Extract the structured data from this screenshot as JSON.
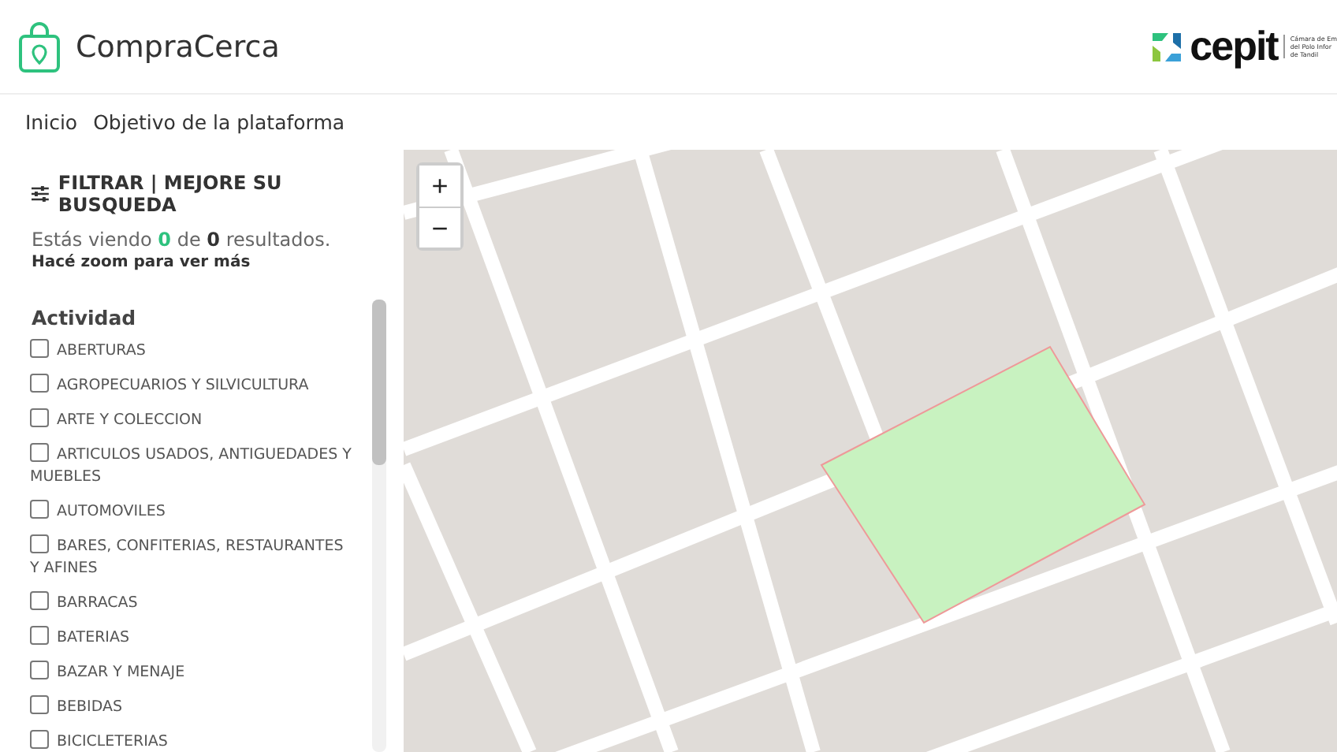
{
  "header": {
    "brand": "CompraCerca",
    "partner_logo": {
      "name": "cepit",
      "tagline": [
        "Cámara de Em",
        "del Polo Infor",
        "de Tandil"
      ]
    }
  },
  "nav": [
    "Inicio",
    "Objetivo de la plataforma"
  ],
  "filter": {
    "title": "FILTRAR | MEJORE SU BUSQUEDA",
    "results": "Estás viendo **0** de **0** resultados.",
    "hint": "Hacé zoom para ver más",
    "section": "Actividad",
    "items": [
      {
        "label": "ABERTURAS",
        "checked": false
      },
      {
        "label": "AGROPECUARIOS Y SILVICULTURA",
        "checked": false
      },
      {
        "label": "ARTE Y COLECCION",
        "checked": false
      },
      {
        "label": "ARTICULOS USADOS, ANTIGUEDADES Y MUEBLES",
        "checked": false
      },
      {
        "label": "AUTOMOVILES",
        "checked": false
      },
      {
        "label": "BARES, CONFITERIAS, RESTAURANTES Y AFINES",
        "checked": false
      },
      {
        "label": "BARRACAS",
        "checked": false
      },
      {
        "label": "BATERIAS",
        "checked": false
      },
      {
        "label": "BAZAR Y MENAJE",
        "checked": false
      },
      {
        "label": "BEBIDAS",
        "checked": false
      },
      {
        "label": "BICICLETERIAS",
        "checked": false
      }
    ]
  },
  "map": {
    "zoom_in": "+",
    "zoom_out": "−"
  }
}
